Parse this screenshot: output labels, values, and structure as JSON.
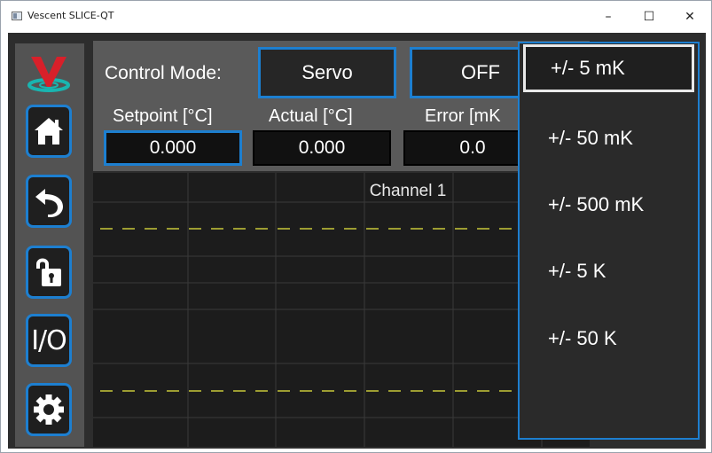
{
  "window": {
    "title": "Vescent SLICE-QT",
    "minimize_glyph": "–",
    "maximize_glyph": "☐",
    "close_glyph": "✕"
  },
  "sidebar": {
    "logo_icon": "vescent-logo-icon",
    "io_label": "I/O"
  },
  "controls": {
    "mode_label": "Control Mode:",
    "mode_value": "Servo",
    "state_value": "OFF"
  },
  "fields": {
    "setpoint_label": "Setpoint [°C]",
    "setpoint_value": "0.000",
    "actual_label": "Actual [°C]",
    "actual_value": "0.000",
    "error_label": "Error [mK",
    "error_value": "0.0"
  },
  "chart": {
    "title": "Channel 1"
  },
  "dropdown": {
    "options": [
      "+/- 5 mK",
      "+/- 50 mK",
      "+/- 500 mK",
      "+/- 5 K",
      "+/- 50 K"
    ],
    "selected_index": 0
  },
  "colors": {
    "accent": "#1d7fd0",
    "limit_line": "#c8c83a",
    "background": "#2d2d2d"
  }
}
